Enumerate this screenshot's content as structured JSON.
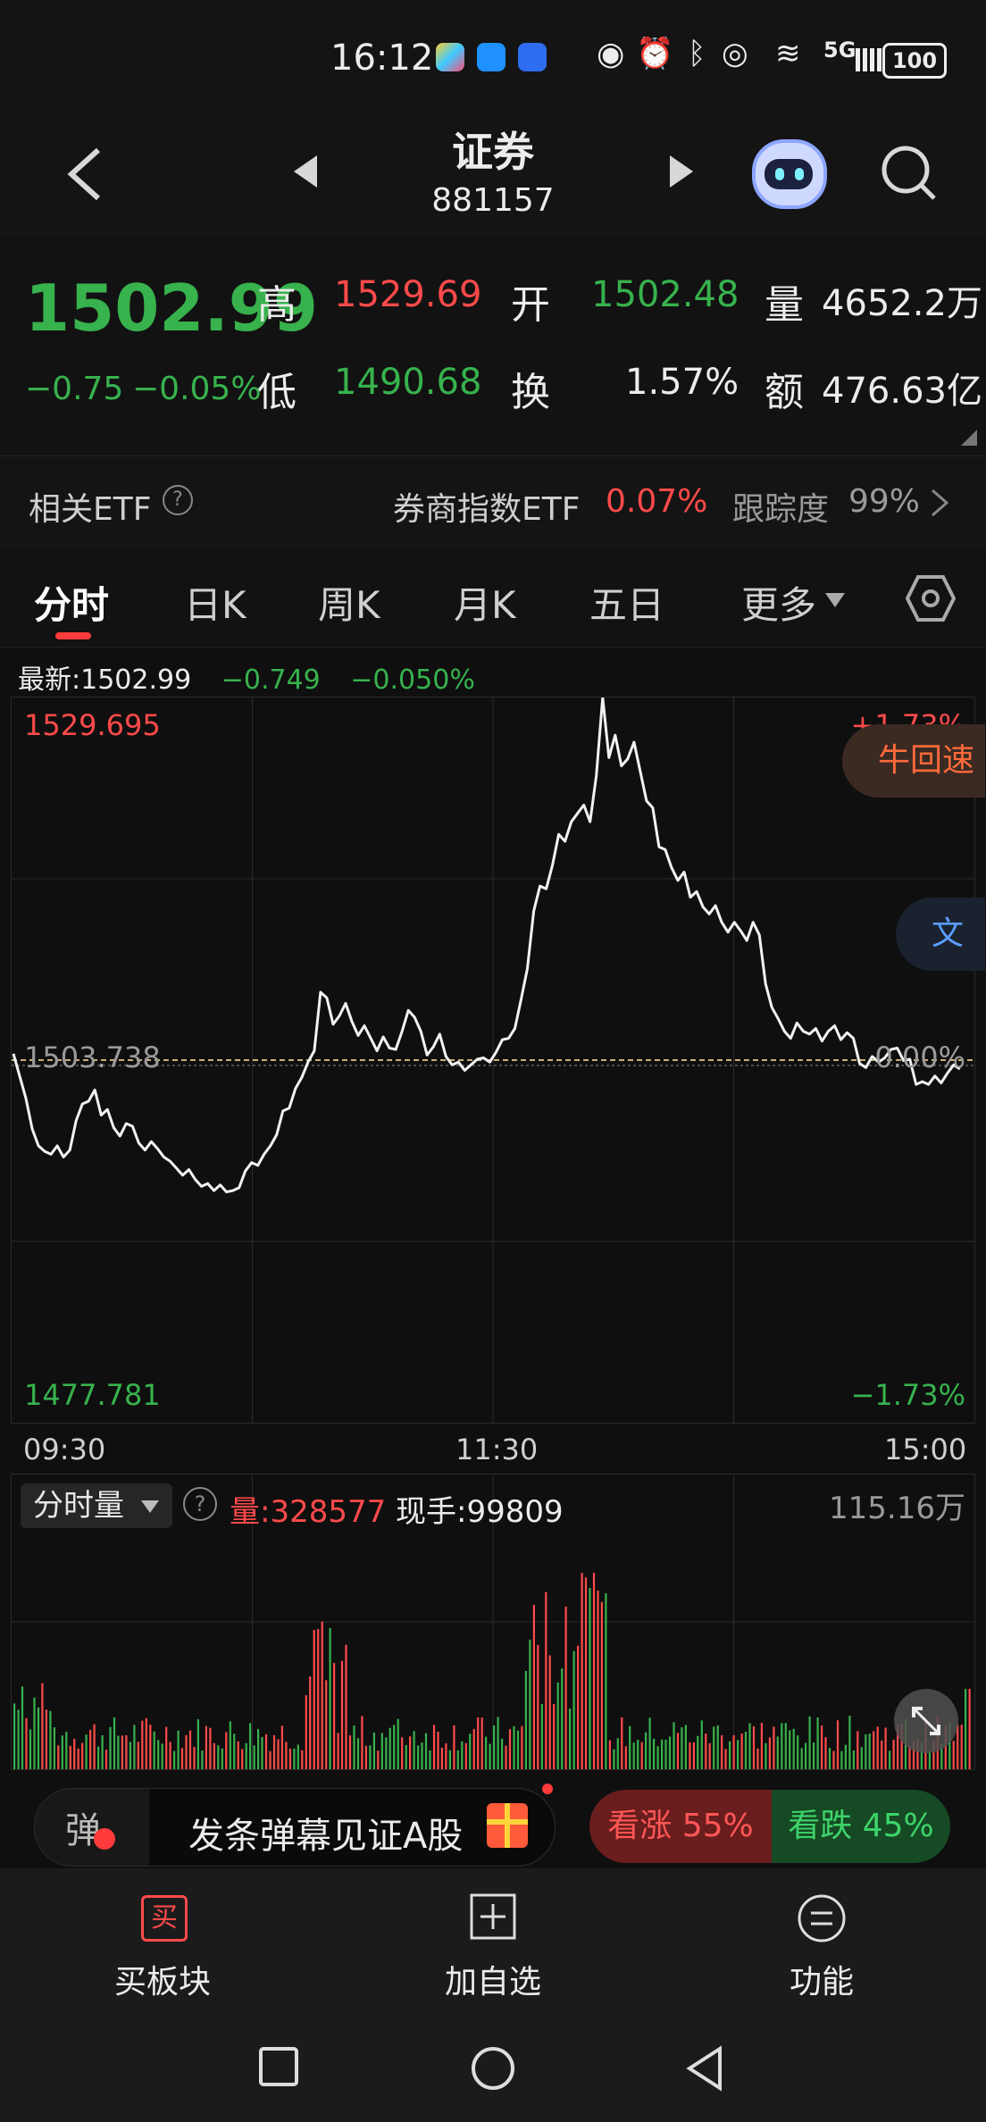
{
  "status_bar": {
    "time": "16:12",
    "battery": "100",
    "signal": "5G"
  },
  "nav": {
    "title": "证券",
    "code": "881157"
  },
  "quote": {
    "price": "1502.99",
    "change": "−0.75",
    "change_pct": "−0.05%",
    "high_label": "高",
    "high": "1529.69",
    "low_label": "低",
    "low": "1490.68",
    "open_label": "开",
    "open": "1502.48",
    "turnover_label": "换",
    "turnover": "1.57%",
    "volume_label": "量",
    "volume": "4652.2万",
    "amount_label": "额",
    "amount": "476.63亿"
  },
  "etf": {
    "label": "相关ETF",
    "name": "券商指数ETF",
    "pct": "0.07%",
    "track_label": "跟踪度",
    "track_value": "99%"
  },
  "tabs": [
    "分时",
    "日K",
    "周K",
    "月K",
    "五日",
    "更多"
  ],
  "info_line": {
    "latest_label": "最新:",
    "latest": "1502.99",
    "change": "−0.749",
    "change_pct": "−0.050%"
  },
  "chart_labels": {
    "top": "1529.695",
    "mid": "1503.738",
    "bottom": "1477.781",
    "top_pct": "+1.73%",
    "mid_pct": "0.00%",
    "bottom_pct": "−1.73%",
    "x_start": "09:30",
    "x_mid": "11:30",
    "x_end": "15:00",
    "badge1": "牛回速",
    "badge2": "文"
  },
  "volume": {
    "selector": "分时量",
    "vol_label": "量:",
    "vol": "328577",
    "hand_label": "现手:",
    "hand": "99809",
    "max": "115.16万"
  },
  "danmu": {
    "placeholder": "发条弹幕见证A股",
    "icon_text": "弹"
  },
  "sentiment": {
    "up": "看涨 55%",
    "down": "看跌 45%"
  },
  "bottom_actions": [
    {
      "label": "买板块",
      "icon": "买"
    },
    {
      "label": "加自选",
      "icon": "plus-icon"
    },
    {
      "label": "功能",
      "icon": "menu-icon"
    }
  ],
  "colors": {
    "up": "#ff4a4a",
    "down": "#37b24d",
    "bg": "#0f0f0f"
  },
  "chart_data": {
    "type": "line",
    "ylim": [
      1477.781,
      1529.695
    ],
    "base": 1503.738,
    "x_ticks": [
      "09:30",
      "11:30",
      "15:00"
    ],
    "series": [
      {
        "values": [
          1504.2,
          1502.6,
          1501.0,
          1498.8,
          1497.6,
          1497.2,
          1497.0,
          1497.6,
          1496.8,
          1497.3,
          1499.4,
          1500.6,
          1500.8,
          1501.6,
          1499.8,
          1500.2,
          1498.9,
          1498.3,
          1499.2,
          1499.0,
          1497.8,
          1497.3,
          1497.9,
          1497.4,
          1496.8,
          1496.5,
          1496.0,
          1495.5,
          1495.9,
          1495.2,
          1494.7,
          1494.9,
          1494.4,
          1494.8,
          1494.3,
          1494.4,
          1494.6,
          1495.8,
          1496.4,
          1496.2,
          1497.0,
          1497.6,
          1498.4,
          1500.1,
          1500.3,
          1501.7,
          1502.5,
          1503.6,
          1504.4,
          1508.6,
          1508.2,
          1506.3,
          1506.9,
          1507.8,
          1506.5,
          1505.5,
          1506.2,
          1505.3,
          1504.4,
          1505.4,
          1504.6,
          1504.5,
          1505.8,
          1507.3,
          1506.8,
          1505.8,
          1504.1,
          1504.7,
          1505.6,
          1504.0,
          1503.4,
          1503.6,
          1503.0,
          1503.4,
          1503.8,
          1503.9,
          1503.6,
          1504.3,
          1505.2,
          1505.3,
          1506.0,
          1508.1,
          1510.3,
          1514.4,
          1516.2,
          1516.0,
          1517.7,
          1519.9,
          1519.4,
          1520.8,
          1521.4,
          1522.0,
          1520.8,
          1524.1,
          1529.7,
          1525.4,
          1527.0,
          1524.8,
          1525.3,
          1526.5,
          1524.4,
          1522.3,
          1521.8,
          1519.0,
          1518.8,
          1517.5,
          1516.6,
          1517.2,
          1515.4,
          1515.8,
          1514.7,
          1514.2,
          1514.8,
          1513.6,
          1512.9,
          1513.6,
          1513.0,
          1512.3,
          1513.6,
          1512.7,
          1509.2,
          1507.5,
          1506.7,
          1505.8,
          1505.3,
          1506.4,
          1505.8,
          1505.6,
          1506.0,
          1505.1,
          1505.8,
          1506.2,
          1505.2,
          1505.7,
          1505.3,
          1503.5,
          1503.2,
          1504.0,
          1503.6,
          1503.9,
          1504.5,
          1504.6,
          1503.7,
          1503.8,
          1502.0,
          1502.2,
          1502.0,
          1502.6,
          1502.1,
          1502.8,
          1503.4,
          1503.1
        ]
      }
    ]
  }
}
